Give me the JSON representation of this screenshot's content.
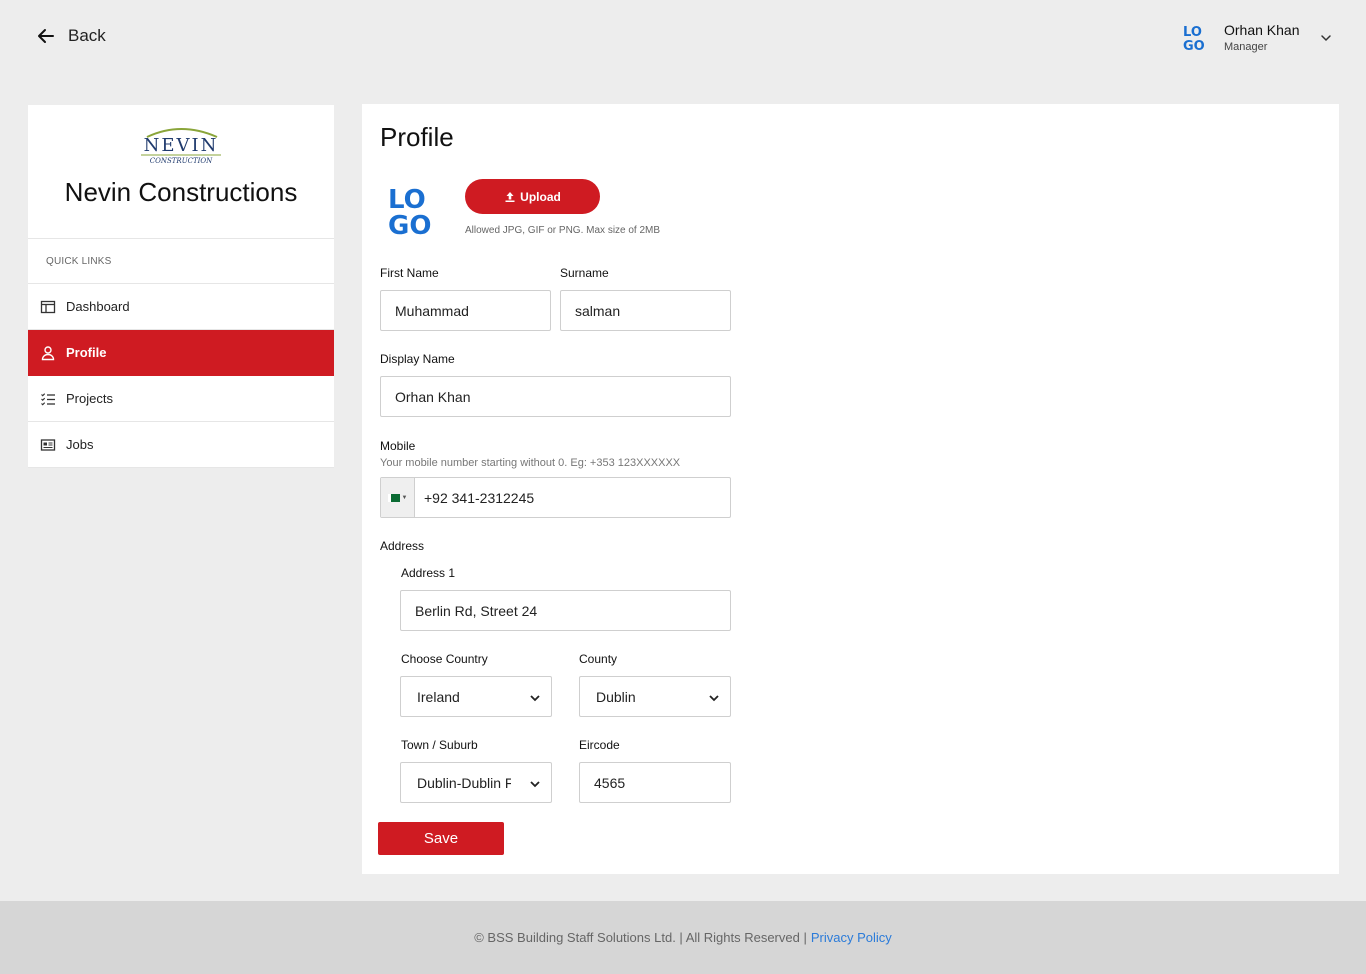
{
  "topbar": {
    "back_label": "Back",
    "user": {
      "name": "Orhan Khan",
      "role": "Manager"
    }
  },
  "sidebar": {
    "brand_logo_text": "NEVIN",
    "brand_logo_subtext": "CONSTRUCTION",
    "company_name": "Nevin Constructions",
    "section_label": "QUICK LINKS",
    "items": [
      {
        "label": "Dashboard",
        "icon": "dashboard-icon",
        "active": false
      },
      {
        "label": "Profile",
        "icon": "user-icon",
        "active": true
      },
      {
        "label": "Projects",
        "icon": "checklist-icon",
        "active": false
      },
      {
        "label": "Jobs",
        "icon": "jobs-icon",
        "active": false
      }
    ]
  },
  "profile": {
    "title": "Profile",
    "upload_label": "Upload",
    "upload_hint": "Allowed JPG, GIF or PNG. Max size of 2MB",
    "first_name": {
      "label": "First Name",
      "value": "Muhammad"
    },
    "surname": {
      "label": "Surname",
      "value": "salman"
    },
    "display_name": {
      "label": "Display Name",
      "value": "Orhan Khan"
    },
    "mobile": {
      "label": "Mobile",
      "hint": "Your mobile number starting without 0. Eg: +353 123XXXXXX",
      "value": "+92 341-2312245",
      "flag": "pakistan-flag-icon"
    },
    "address": {
      "label": "Address",
      "address1": {
        "label": "Address 1",
        "value": "Berlin Rd, Street 24"
      },
      "country": {
        "label": "Choose Country",
        "value": "Ireland"
      },
      "county": {
        "label": "County",
        "value": "Dublin"
      },
      "town": {
        "label": "Town / Suburb",
        "value": "Dublin-Dublin F"
      },
      "eircode": {
        "label": "Eircode",
        "value": "4565"
      }
    },
    "save_label": "Save"
  },
  "footer": {
    "copyright": "© BSS Building Staff Solutions Ltd. | All Rights Reserved |",
    "privacy_link": "Privacy Policy"
  },
  "colors": {
    "accent": "#cf1b22",
    "logo_blue": "#1a6fd1",
    "link": "#2b7bd9"
  }
}
